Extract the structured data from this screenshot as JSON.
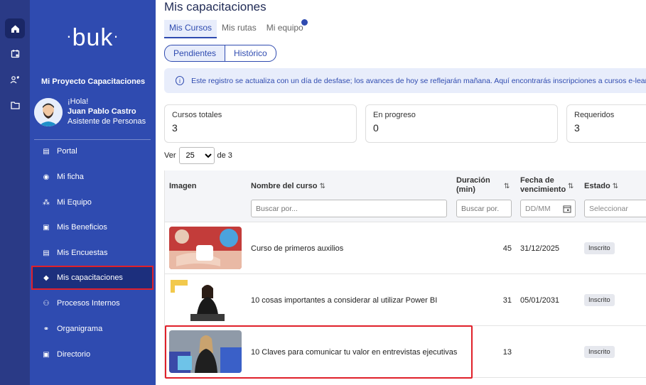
{
  "brand": {
    "logo_text": "buk"
  },
  "sidebar": {
    "project": "Mi Proyecto Capacitaciones",
    "greeting": "¡Hola!",
    "user_name": "Juan Pablo Castro",
    "user_role": "Asistente de Personas",
    "items": [
      {
        "label": "Portal",
        "icon": "document-icon"
      },
      {
        "label": "Mi ficha",
        "icon": "id-icon"
      },
      {
        "label": "Mi Equipo",
        "icon": "team-icon"
      },
      {
        "label": "Mis Beneficios",
        "icon": "gift-icon"
      },
      {
        "label": "Mis Encuestas",
        "icon": "survey-icon"
      },
      {
        "label": "Mis capacitaciones",
        "icon": "graduation-cap-icon",
        "active": true
      },
      {
        "label": "Procesos Internos",
        "icon": "process-icon"
      },
      {
        "label": "Organigrama",
        "icon": "org-chart-icon"
      },
      {
        "label": "Directorio",
        "icon": "directory-icon"
      }
    ]
  },
  "rail": [
    "home-icon",
    "calendar-icon",
    "people-heart-icon",
    "folder-icon"
  ],
  "main": {
    "title": "Mis capacitaciones",
    "tabs": [
      "Mis Cursos",
      "Mis rutas",
      "Mi equipo"
    ],
    "segments": [
      "Pendientes",
      "Histórico"
    ],
    "banner": "Este registro se actualiza con un día de desfase; los avances de hoy se reflejarán mañana. Aquí encontrarás inscripciones a cursos e-learning",
    "stats": [
      {
        "label": "Cursos totales",
        "value": "3"
      },
      {
        "label": "En progreso",
        "value": "0"
      },
      {
        "label": "Requeridos",
        "value": "3"
      }
    ],
    "pager": {
      "prefix": "Ver",
      "per_page": "25",
      "suffix": "de 3"
    },
    "columns": {
      "image": "Imagen",
      "name": "Nombre del curso",
      "duration": "Duración (min)",
      "due": "Fecha de vencimiento",
      "status": "Estado"
    },
    "filters": {
      "name": "Buscar por...",
      "duration": "Buscar por.",
      "due": "DD/MM",
      "status": "Seleccionar"
    },
    "rows": [
      {
        "name": "Curso de primeros auxilios",
        "duration": "45",
        "due": "31/12/2025",
        "status": "Inscrito"
      },
      {
        "name": "10 cosas importantes a considerar al utilizar Power BI",
        "duration": "31",
        "due": "05/01/2031",
        "status": "Inscrito"
      },
      {
        "name": "10 Claves para comunicar tu valor en entrevistas ejecutivas",
        "duration": "13",
        "due": "",
        "status": "Inscrito"
      }
    ]
  },
  "colors": {
    "sidebar": "#2f4bb0",
    "rail": "#2a3a86",
    "accent": "#2f4bb0",
    "highlight": "#e0202a"
  }
}
